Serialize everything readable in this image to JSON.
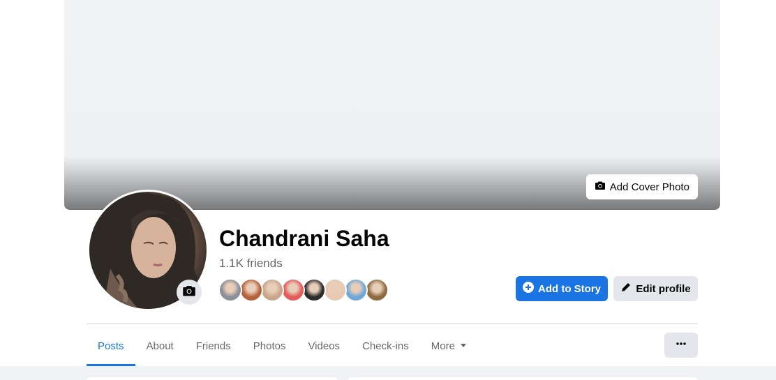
{
  "cover": {
    "add_cover_label": "Add Cover Photo",
    "icon": "camera-icon"
  },
  "profile": {
    "name": "Chandrani Saha",
    "friends_count": "1.1K friends",
    "avatar_camera_icon": "camera-icon",
    "friend_avatar_colors": [
      "#8a8f98",
      "#b7623a",
      "#c9a58c",
      "#e45a5a",
      "#2b2b2b",
      "#e8c9b0",
      "#6fa7d9",
      "#8d6b3f"
    ]
  },
  "actions": {
    "add_story_label": "Add to Story",
    "add_story_icon": "plus-circle-icon",
    "edit_profile_label": "Edit profile",
    "edit_profile_icon": "pencil-icon",
    "more_icon": "ellipsis-icon"
  },
  "tabs": [
    {
      "label": "Posts",
      "active": true
    },
    {
      "label": "About",
      "active": false
    },
    {
      "label": "Friends",
      "active": false
    },
    {
      "label": "Photos",
      "active": false
    },
    {
      "label": "Videos",
      "active": false
    },
    {
      "label": "Check-ins",
      "active": false
    },
    {
      "label": "More",
      "active": false
    }
  ],
  "colors": {
    "accent": "#1b74e4",
    "secondary_button": "#e4e6eb",
    "page_background": "#f0f2f5"
  }
}
